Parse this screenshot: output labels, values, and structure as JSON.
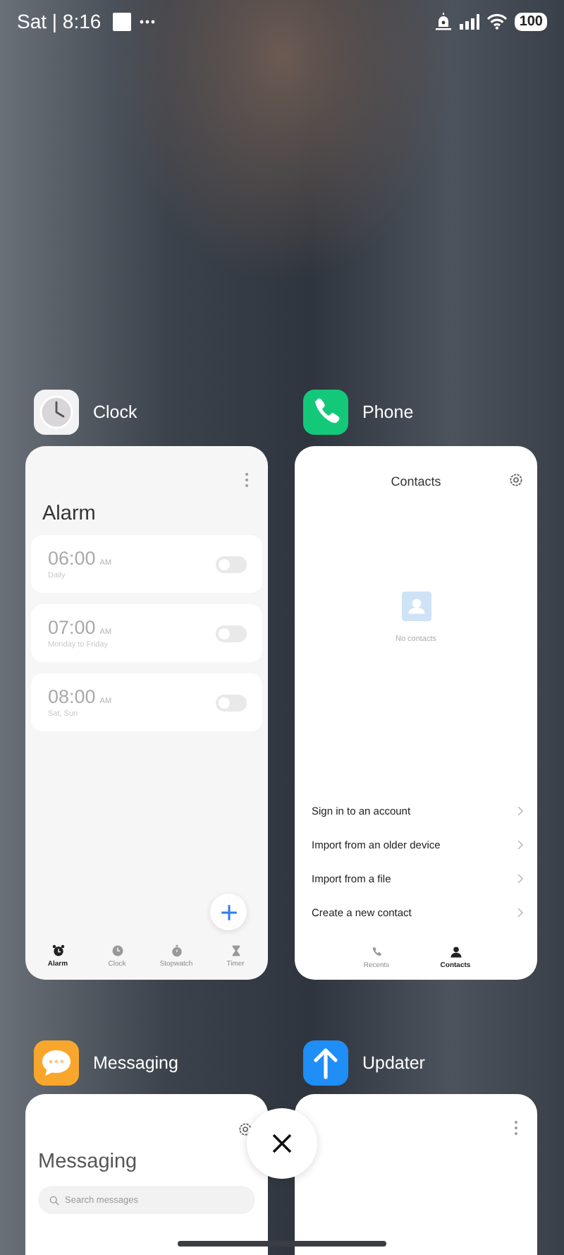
{
  "status_bar": {
    "time": "Sat | 8:16",
    "battery": "100"
  },
  "apps": [
    {
      "kind": "clock",
      "name": "Clock",
      "title": "Alarm",
      "alarms": [
        {
          "time": "06:00",
          "period": "AM",
          "repeat": "Daily",
          "on": false
        },
        {
          "time": "07:00",
          "period": "AM",
          "repeat": "Monday to Friday",
          "on": false
        },
        {
          "time": "08:00",
          "period": "AM",
          "repeat": "Sat, Sun",
          "on": false
        }
      ],
      "tabs": [
        {
          "label": "Alarm",
          "selected": true
        },
        {
          "label": "Clock",
          "selected": false
        },
        {
          "label": "Stopwatch",
          "selected": false
        },
        {
          "label": "Timer",
          "selected": false
        }
      ]
    },
    {
      "kind": "phone",
      "name": "Phone",
      "title": "Contacts",
      "empty_text": "No contacts",
      "actions": [
        "Sign in to an account",
        "Import from an older device",
        "Import from a file",
        "Create a new contact"
      ],
      "tabs": [
        {
          "label": "Recents",
          "selected": false
        },
        {
          "label": "Contacts",
          "selected": true
        }
      ]
    },
    {
      "kind": "messaging",
      "name": "Messaging",
      "title": "Messaging",
      "search": {
        "placeholder": "Search messages"
      }
    },
    {
      "kind": "updater",
      "name": "Updater"
    }
  ]
}
